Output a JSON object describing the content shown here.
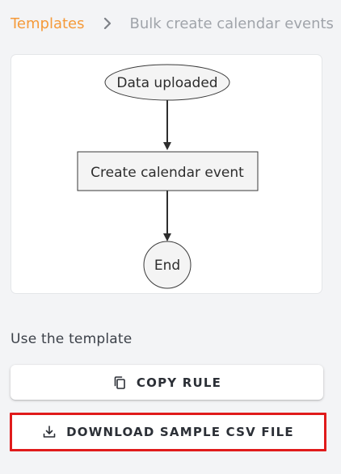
{
  "breadcrumb": {
    "link_label": "Templates",
    "current_label": "Bulk create calendar events"
  },
  "flow": {
    "nodes": [
      {
        "label": "Data uploaded",
        "shape": "ellipse"
      },
      {
        "label": "Create calendar event",
        "shape": "rectangle"
      },
      {
        "label": "End",
        "shape": "circle"
      }
    ]
  },
  "use_template": {
    "title": "Use the template",
    "copy_rule_label": "COPY RULE",
    "copy_rule_icon": "copy-icon",
    "download_label": "DOWNLOAD SAMPLE CSV FILE",
    "download_icon": "download-icon"
  },
  "colors": {
    "accent": "#f59a3a",
    "highlight_border": "#e01b1b",
    "node_fill": "#f4f4f4",
    "node_stroke": "#3a3a3a"
  }
}
